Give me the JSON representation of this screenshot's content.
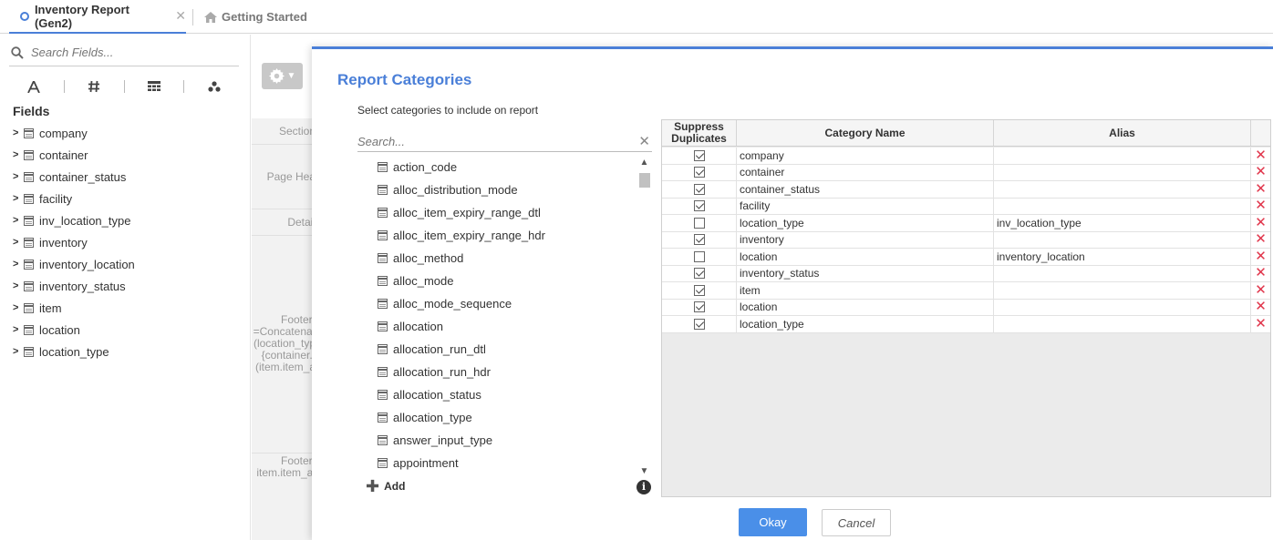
{
  "tabs": [
    {
      "label": "Inventory Report (Gen2)",
      "active": true
    },
    {
      "label": "Getting Started",
      "active": false
    }
  ],
  "sidebar": {
    "search_placeholder": "Search Fields...",
    "fields_heading": "Fields",
    "fields": [
      "company",
      "container",
      "container_status",
      "facility",
      "inv_location_type",
      "inventory",
      "inventory_location",
      "inventory_status",
      "item",
      "location",
      "location_type"
    ]
  },
  "designer": {
    "sections": [
      {
        "label": "Section"
      },
      {
        "label": "Page Hea"
      },
      {
        "label": "Detail"
      },
      {
        "label": "Footer:\n=Concatenat\n(location_typ\n{container.t\n(item.item_a"
      },
      {
        "label": "Footer:\nitem.item_al"
      }
    ]
  },
  "modal": {
    "title": "Report Categories",
    "subtitle": "Select categories to include on report",
    "search_placeholder": "Search...",
    "categories": [
      "action_code",
      "alloc_distribution_mode",
      "alloc_item_expiry_range_dtl",
      "alloc_item_expiry_range_hdr",
      "alloc_method",
      "alloc_mode",
      "alloc_mode_sequence",
      "allocation",
      "allocation_run_dtl",
      "allocation_run_hdr",
      "allocation_status",
      "allocation_type",
      "answer_input_type",
      "appointment"
    ],
    "add_label": "Add",
    "grid": {
      "headers": {
        "suppress": "Suppress\nDuplicates",
        "name": "Category Name",
        "alias": "Alias"
      },
      "rows": [
        {
          "suppress": true,
          "name": "company",
          "alias": ""
        },
        {
          "suppress": true,
          "name": "container",
          "alias": ""
        },
        {
          "suppress": true,
          "name": "container_status",
          "alias": ""
        },
        {
          "suppress": true,
          "name": "facility",
          "alias": ""
        },
        {
          "suppress": false,
          "name": "location_type",
          "alias": "inv_location_type"
        },
        {
          "suppress": true,
          "name": "inventory",
          "alias": ""
        },
        {
          "suppress": false,
          "name": "location",
          "alias": "inventory_location"
        },
        {
          "suppress": true,
          "name": "inventory_status",
          "alias": ""
        },
        {
          "suppress": true,
          "name": "item",
          "alias": ""
        },
        {
          "suppress": true,
          "name": "location",
          "alias": ""
        },
        {
          "suppress": true,
          "name": "location_type",
          "alias": ""
        }
      ]
    },
    "okay_label": "Okay",
    "cancel_label": "Cancel"
  },
  "colors": {
    "accent": "#4a7fd8",
    "delete": "#e0344a",
    "okay_button": "#4a8fe8"
  }
}
